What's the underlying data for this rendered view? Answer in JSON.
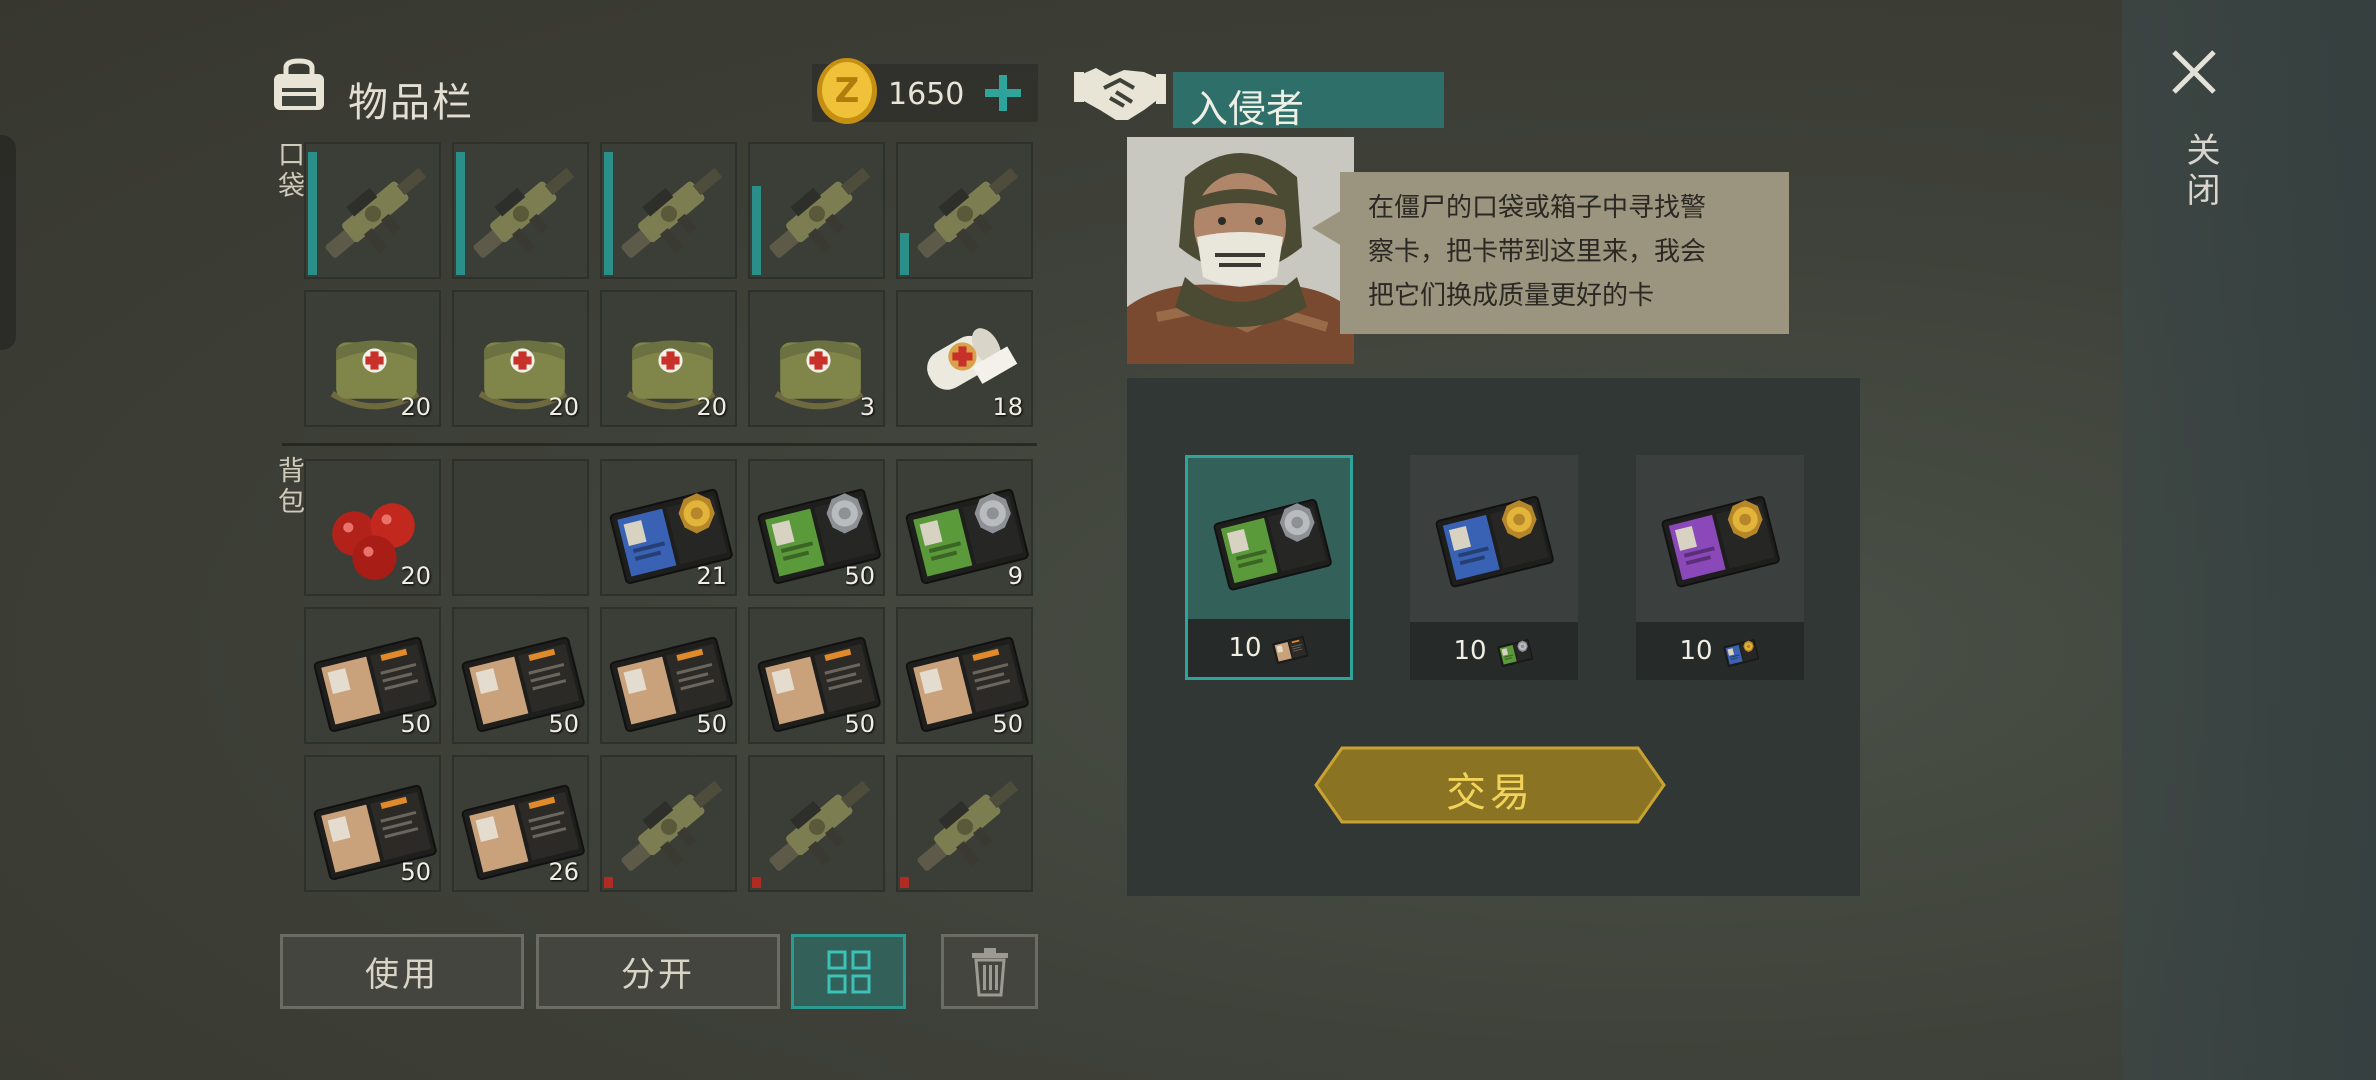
{
  "inventory": {
    "title": "物品栏",
    "coins": "1650",
    "pocket_label": "口袋",
    "backpack_label": "背包",
    "pocket_slots": [
      {
        "item": "grenade-launcher",
        "count": "",
        "durability": 0.94
      },
      {
        "item": "grenade-launcher",
        "count": "",
        "durability": 0.94
      },
      {
        "item": "grenade-launcher",
        "count": "",
        "durability": 0.94
      },
      {
        "item": "grenade-launcher",
        "count": "",
        "durability": 0.68
      },
      {
        "item": "grenade-launcher",
        "count": "",
        "durability": 0.32
      },
      {
        "item": "medical-bag",
        "count": "20"
      },
      {
        "item": "medical-bag",
        "count": "20"
      },
      {
        "item": "medical-bag",
        "count": "20"
      },
      {
        "item": "medical-bag",
        "count": "3"
      },
      {
        "item": "bandage",
        "count": "18"
      }
    ],
    "backpack_slots": [
      {
        "item": "tomatoes",
        "count": "20"
      },
      {
        "item": "empty",
        "count": ""
      },
      {
        "item": "police-card-blue-gold",
        "count": "21"
      },
      {
        "item": "police-card-green-silver",
        "count": "50"
      },
      {
        "item": "police-card-green-silver",
        "count": "9"
      },
      {
        "item": "patrol-officer-card",
        "count": "50"
      },
      {
        "item": "patrol-officer-card",
        "count": "50"
      },
      {
        "item": "patrol-officer-card",
        "count": "50"
      },
      {
        "item": "patrol-officer-card",
        "count": "50"
      },
      {
        "item": "patrol-officer-card",
        "count": "50"
      },
      {
        "item": "patrol-officer-card",
        "count": "50"
      },
      {
        "item": "patrol-officer-card",
        "count": "26"
      },
      {
        "item": "grenade-launcher",
        "count": "",
        "broken": true
      },
      {
        "item": "grenade-launcher",
        "count": "",
        "broken": true
      },
      {
        "item": "grenade-launcher",
        "count": "",
        "broken": true
      }
    ],
    "buttons": {
      "use": "使用",
      "split": "分开"
    }
  },
  "trader": {
    "name": "入侵者",
    "speech": [
      "在僵尸的口袋或箱子中寻找警",
      "察卡，把卡带到这里来，我会",
      "把它们换成质量更好的卡"
    ],
    "offers": [
      {
        "item": "police-card-green-silver",
        "cost": "10",
        "cost_item": "patrol-officer-card",
        "selected": true
      },
      {
        "item": "police-card-blue-gold",
        "cost": "10",
        "cost_item": "police-card-green-silver",
        "selected": false
      },
      {
        "item": "police-card-purple-gold",
        "cost": "10",
        "cost_item": "police-card-blue-gold",
        "selected": false
      }
    ],
    "trade_label": "交易"
  },
  "close_label": "关闭",
  "colors": {
    "accent": "#2fa49b",
    "trade_gold": "#8a7424",
    "durability": "#2a8f89",
    "broken": "#b02b22"
  },
  "icons": [
    "backpack-icon",
    "coin-icon",
    "plus-icon",
    "handshake-icon",
    "grid-icon",
    "trash-icon",
    "close-icon"
  ]
}
